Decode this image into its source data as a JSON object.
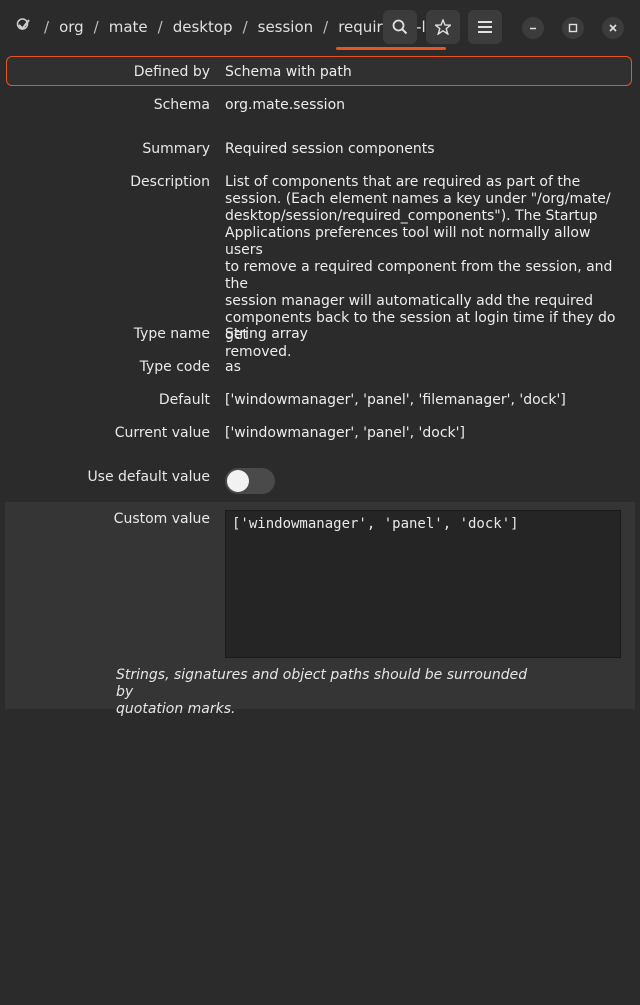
{
  "header": {
    "breadcrumbs": [
      "org",
      "mate",
      "desktop",
      "session"
    ],
    "active_crumb": "requir… ts-list",
    "separator": "/"
  },
  "fields": {
    "defined_by": {
      "label": "Defined by",
      "value": "Schema with path"
    },
    "schema": {
      "label": "Schema",
      "value": "org.mate.session"
    },
    "summary": {
      "label": "Summary",
      "value": "Required session components"
    },
    "description": {
      "label": "Description",
      "lines": [
        "List of components that are required as part of the",
        "session. (Each element names a key under \"/org/mate/",
        "desktop/session/required_components\"). The Startup",
        "Applications preferences tool will not normally allow users",
        "to remove a required component from the session, and the",
        "session manager will automatically add the required",
        "components back to the session at login time if they do get",
        "removed."
      ]
    },
    "type_name": {
      "label": "Type name",
      "value": "String array"
    },
    "type_code": {
      "label": "Type code",
      "value": "as"
    },
    "default": {
      "label": "Default",
      "value": "['windowmanager', 'panel', 'filemanager', 'dock']"
    },
    "current_value": {
      "label": "Current value",
      "value": "['windowmanager', 'panel', 'dock']"
    }
  },
  "use_default": {
    "label": "Use default value",
    "enabled": false
  },
  "custom_value": {
    "label": "Custom value",
    "text": "['windowmanager', 'panel', 'dock']",
    "hint_lines": [
      "Strings, signatures and object paths should be surrounded by",
      "quotation marks."
    ]
  },
  "colors": {
    "accent": "#e95420",
    "background": "#2b2b2b",
    "custom_block": "#353535"
  },
  "icons": [
    "dconf-logo-icon",
    "search-icon",
    "star-icon",
    "menu-icon",
    "minimize-icon",
    "maximize-icon",
    "close-icon"
  ]
}
